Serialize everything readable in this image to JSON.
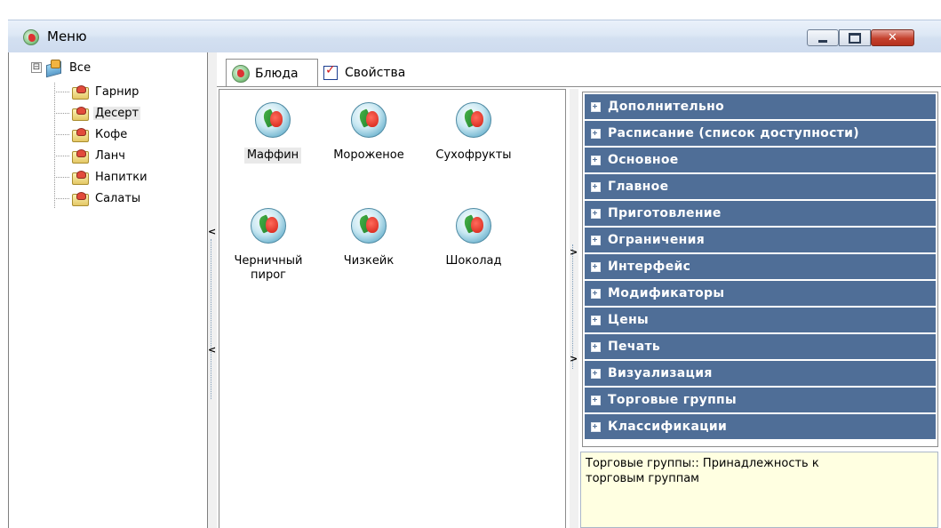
{
  "window": {
    "title": "Меню",
    "controls": {
      "minimize": "minimize-icon",
      "maximize": "maximize-icon",
      "close": "✕"
    }
  },
  "tree": {
    "root": {
      "expander": "⊟",
      "label": "Все"
    },
    "items": [
      {
        "label": "Гарнир",
        "selected": false
      },
      {
        "label": "Десерт",
        "selected": true
      },
      {
        "label": "Кофе",
        "selected": false
      },
      {
        "label": "Ланч",
        "selected": false
      },
      {
        "label": "Напитки",
        "selected": false
      },
      {
        "label": "Салаты",
        "selected": false
      }
    ]
  },
  "splitters": {
    "left_arrow": "<",
    "right_arrow": ">"
  },
  "tabs": [
    {
      "label": "Блюда",
      "active": true
    },
    {
      "label": "Свойства",
      "active": false
    }
  ],
  "dishes": [
    {
      "line1": "Маффин",
      "line2": "",
      "selected": true
    },
    {
      "line1": "Мороженое",
      "line2": "",
      "selected": false
    },
    {
      "line1": "Сухофрукты",
      "line2": "",
      "selected": false
    },
    {
      "line1": "Черничный",
      "line2": "пирог",
      "selected": false
    },
    {
      "line1": "Чизкейк",
      "line2": "",
      "selected": false
    },
    {
      "line1": "Шоколад",
      "line2": "",
      "selected": false
    }
  ],
  "properties": {
    "categories": [
      "Дополнительно",
      "Расписание (список доступности)",
      "Основное",
      "Главное",
      "Приготовление",
      "Ограничения",
      "Интерфейс",
      "Модификаторы",
      "Цены",
      "Печать",
      "Визуализация",
      "Торговые группы",
      "Классификации"
    ],
    "description_line1": "Торговые группы:: Принадлежность к",
    "description_line2": "торговым группам"
  },
  "colors": {
    "category_bg": "#4f6e97",
    "description_bg": "#ffffe1",
    "selection_bg": "#e9e9e9"
  }
}
